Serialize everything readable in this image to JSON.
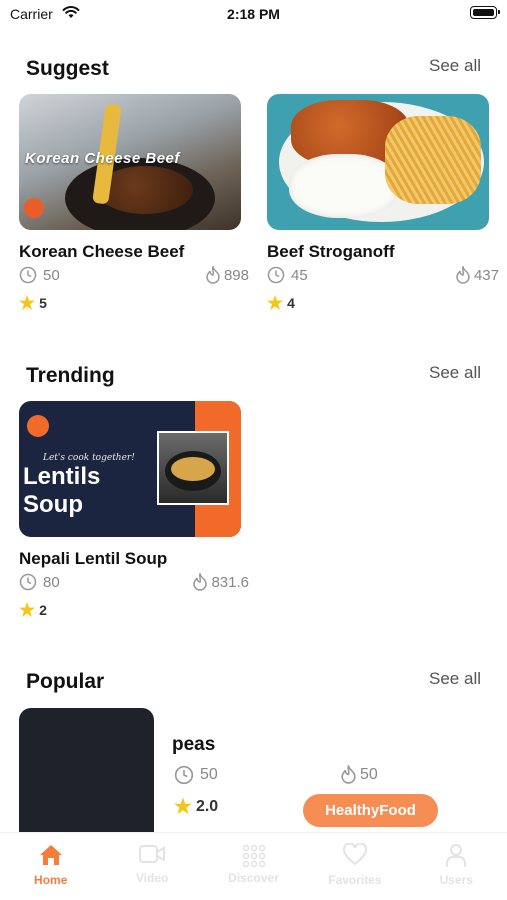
{
  "status_bar": {
    "carrier": "Carrier",
    "time": "2:18 PM"
  },
  "sections": {
    "suggest": {
      "title": "Suggest",
      "see_all": "See all"
    },
    "trending": {
      "title": "Trending",
      "see_all": "See all"
    },
    "popular": {
      "title": "Popular",
      "see_all": "See all"
    }
  },
  "suggest_cards": [
    {
      "title": "Korean Cheese Beef",
      "time": "50",
      "calories": "898",
      "rating": "5",
      "image_text": "Korean Cheese Beef"
    },
    {
      "title": "Beef Stroganoff",
      "time": "45",
      "calories": "437",
      "rating": "4"
    }
  ],
  "trending_cards": [
    {
      "title": "Nepali Lentil Soup",
      "time": "80",
      "calories": "831.6",
      "rating": "2",
      "image_tagline": "Let's cook together!",
      "image_title_1": "Lentils",
      "image_title_2": "Soup"
    }
  ],
  "popular_item": {
    "title": "peas",
    "time": "50",
    "calories": "50",
    "rating": "2.0",
    "tag": "HealthyFood"
  },
  "tab_bar": {
    "items": [
      {
        "label": "Home",
        "icon": "home-icon",
        "active": true
      },
      {
        "label": "Video",
        "icon": "video-icon",
        "active": false
      },
      {
        "label": "Discover",
        "icon": "grid-icon",
        "active": false
      },
      {
        "label": "Favorites",
        "icon": "heart-icon",
        "active": false
      },
      {
        "label": "Users",
        "icon": "user-icon",
        "active": false
      }
    ]
  },
  "colors": {
    "accent": "#f57c3a",
    "tag": "#f58d55",
    "star": "#f5c518",
    "inactive": "#e3e3e3"
  }
}
